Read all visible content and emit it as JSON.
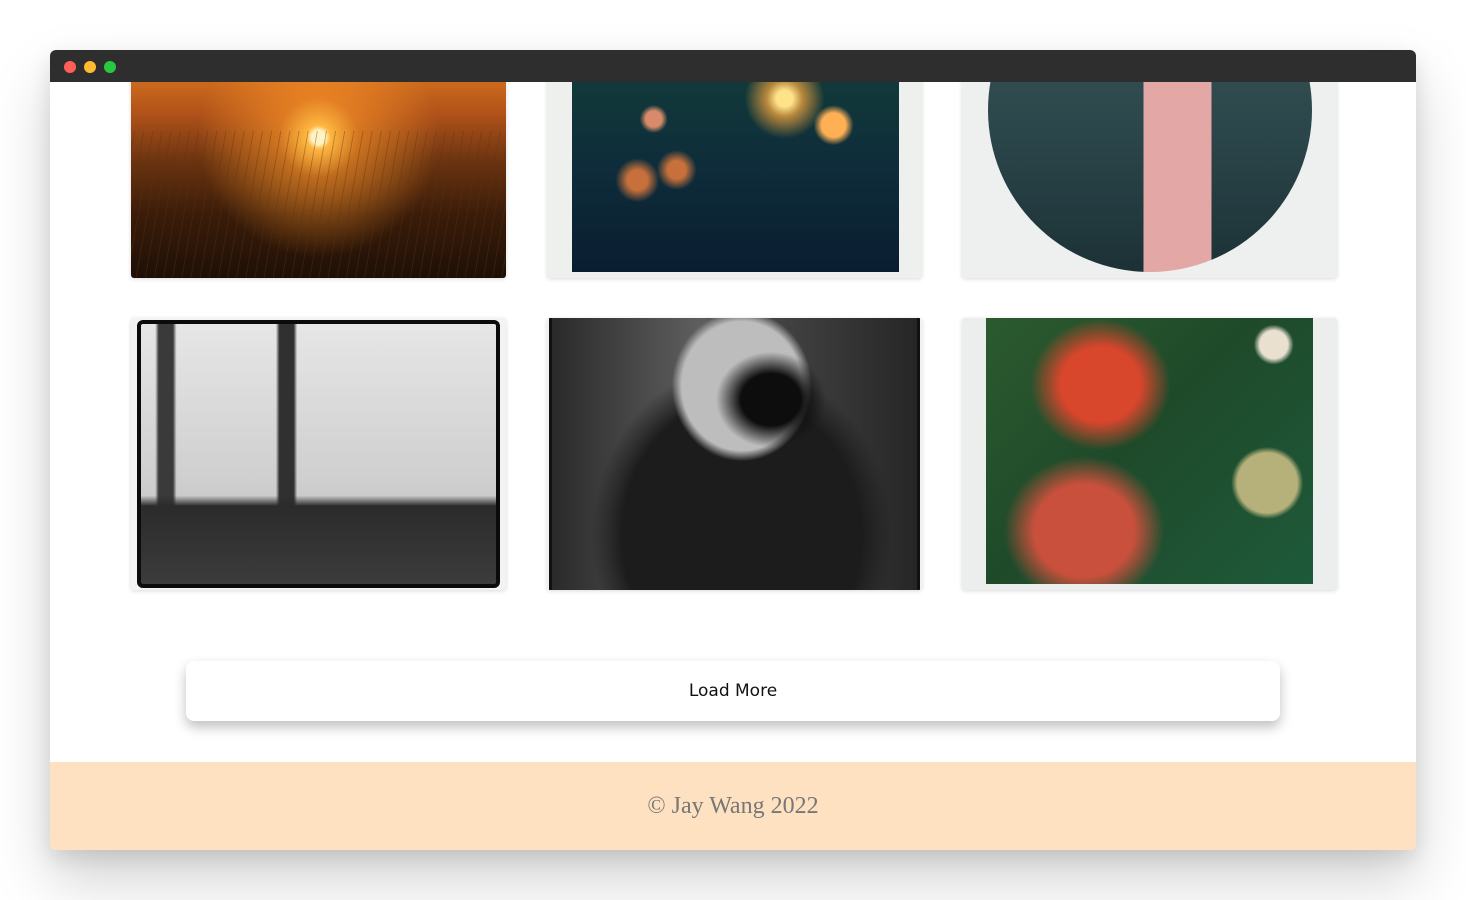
{
  "window": {
    "controls": [
      "close",
      "minimize",
      "maximize"
    ]
  },
  "gallery": {
    "photos": [
      {
        "name": "sunset-grass-photo"
      },
      {
        "name": "polaroid-bokeh-flowers-photo"
      },
      {
        "name": "polaroid-circle-shadow-photo"
      },
      {
        "name": "bw-trees-landscape-photo"
      },
      {
        "name": "bw-woman-flower-portrait-photo"
      },
      {
        "name": "polaroid-color-double-exposure-photo"
      }
    ]
  },
  "load_more": {
    "label": "Load More"
  },
  "footer": {
    "copyright": "© Jay Wang 2022",
    "background": "#fee1c1"
  }
}
